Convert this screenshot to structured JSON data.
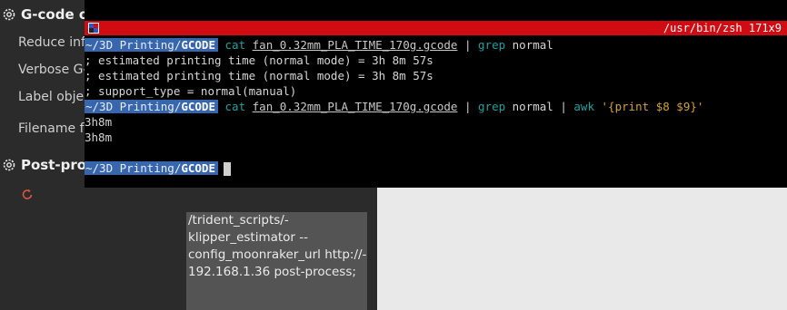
{
  "settings": {
    "section1_title": "G-code ou",
    "options": [
      "Reduce inf",
      "Verbose G-",
      "Label obje",
      "Filename f"
    ],
    "section2_title": "Post-proc",
    "postprocess_lines": [
      "/trident_scripts/-",
      "klipper_estimator --",
      "config_moonraker_url http://-",
      "192.168.1.36 post-process;"
    ]
  },
  "terminal": {
    "title": "/usr/bin/zsh 171x9",
    "prompt_path": "~/3D Printing/",
    "prompt_dir": "GCODE",
    "cmd1": {
      "cat": "cat",
      "file": "fan_0.32mm_PLA_TIME_170g.gcode",
      "pipe": "|",
      "grep": "grep",
      "arg": "normal"
    },
    "output1": [
      "; estimated printing time (normal mode) = 3h 8m 57s",
      "; estimated printing time (normal mode) = 3h 8m 57s",
      "; support_type = normal(manual)"
    ],
    "cmd2": {
      "cat": "cat",
      "file": "fan_0.32mm_PLA_TIME_170g.gcode",
      "pipe": "|",
      "grep": "grep",
      "arg": "normal",
      "pipe2": "|",
      "awk": "awk",
      "script": "'{print $8 $9}'"
    },
    "output2": [
      "3h8m",
      "3h8m"
    ]
  }
}
